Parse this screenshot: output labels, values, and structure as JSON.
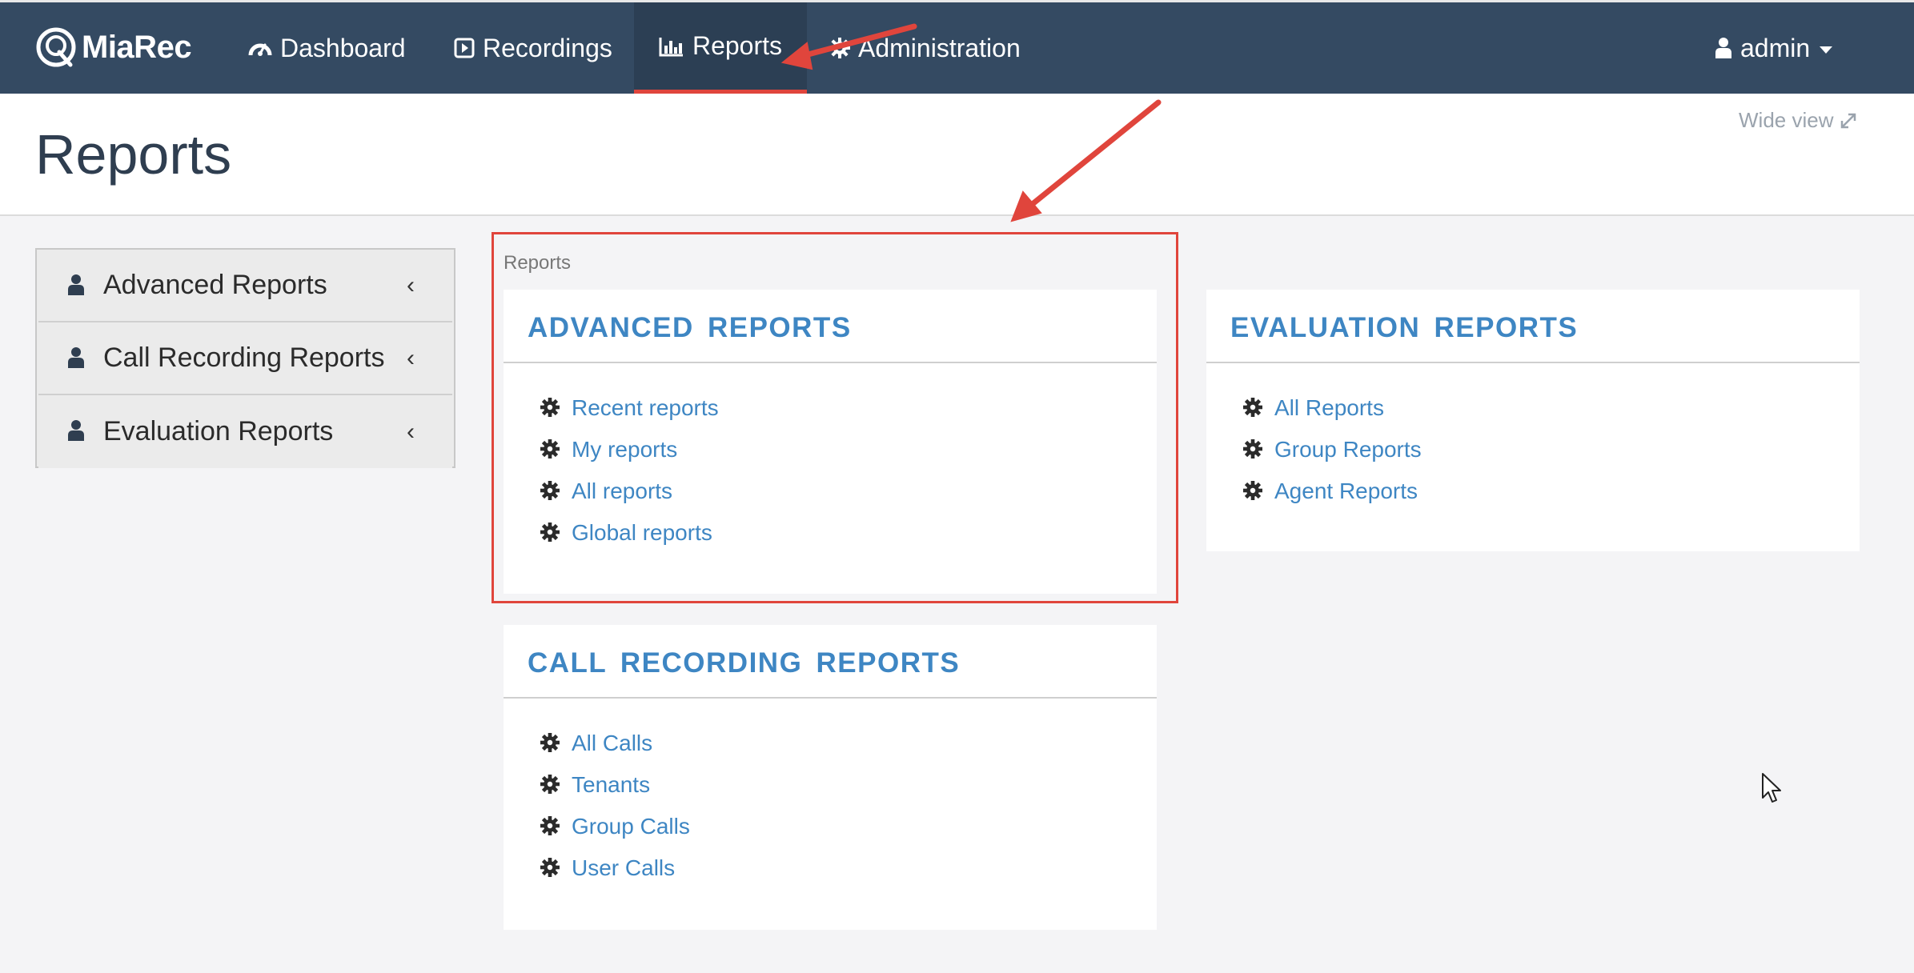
{
  "brand": {
    "name": "MiaRec"
  },
  "nav": {
    "items": [
      {
        "label": "Dashboard",
        "icon": "dashboard-icon"
      },
      {
        "label": "Recordings",
        "icon": "play-icon"
      },
      {
        "label": "Reports",
        "icon": "bar-chart-icon",
        "active": true
      },
      {
        "label": "Administration",
        "icon": "gear-icon"
      }
    ],
    "user": {
      "label": "admin",
      "icon": "user-icon"
    }
  },
  "header": {
    "title": "Reports",
    "wide_view": "Wide view"
  },
  "sidebar": {
    "items": [
      {
        "label": "Advanced Reports"
      },
      {
        "label": "Call Recording Reports"
      },
      {
        "label": "Evaluation Reports"
      }
    ]
  },
  "breadcrumb": "Reports",
  "panels": {
    "advanced": {
      "title": "ADVANCED REPORTS",
      "links": [
        "Recent reports",
        "My reports",
        "All reports",
        "Global reports"
      ]
    },
    "evaluation": {
      "title": "EVALUATION REPORTS",
      "links": [
        "All Reports",
        "Group Reports",
        "Agent Reports"
      ]
    },
    "call_recording": {
      "title": "CALL RECORDING REPORTS",
      "links": [
        "All Calls",
        "Tenants",
        "Group Calls",
        "User Calls"
      ]
    }
  },
  "colors": {
    "navbar": "#344a62",
    "active_underline": "#e0453c",
    "link": "#3e86c3",
    "annotation": "#e0453c"
  }
}
